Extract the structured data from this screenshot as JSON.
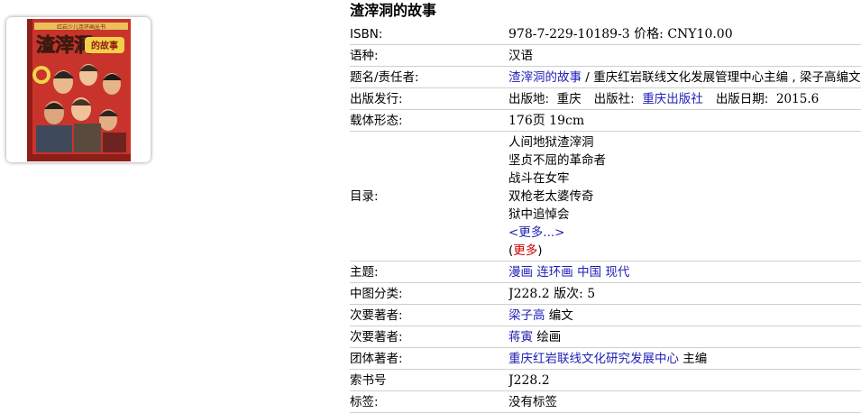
{
  "colors": {
    "link": "#1f1fb5",
    "more_red": "#cc0000",
    "divider": "#cfcfcf"
  },
  "book": {
    "title": "渣滓洞的故事",
    "cover_texts": {
      "series": "红岩少儿连环画丛书",
      "title": "渣滓洞",
      "subtitle": "的故事"
    }
  },
  "labels": {
    "isbn": "ISBN:",
    "language": "语种:",
    "title_resp": "题名/责任者:",
    "publication": "出版发行:",
    "physical": "载体形态:",
    "toc": "目录:",
    "subject": "主题:",
    "clc": "中图分类:",
    "author2a": "次要著者:",
    "author2b": "次要著者:",
    "corporate": "团体著者:",
    "call_no": "索书号",
    "tags": "标签:"
  },
  "values": {
    "isbn": "978-7-229-10189-3 价格:   CNY10.00",
    "language": "汉语",
    "title_link": "渣滓洞的故事",
    "title_rest": " / 重庆红岩联线文化发展管理中心主编 , 梁子高编文",
    "pub_place_label": "出版地:",
    "pub_place": "重庆",
    "publisher_label": "出版社:",
    "publisher": "重庆出版社",
    "pub_date_label": "出版日期:",
    "pub_date": "2015.6",
    "physical": "176页 19cm",
    "toc_items": [
      "人间地狱渣滓洞",
      "坚贞不屈的革命者",
      "战斗在女牢",
      "双枪老太婆传奇",
      "狱中追悼会"
    ],
    "toc_more_link": "<更多...>",
    "toc_more_open": "(",
    "toc_more_red": "更多",
    "toc_more_close": ")",
    "subjects": [
      "漫画",
      "连环画",
      "中国",
      "现代"
    ],
    "clc": "J228.2 版次:   5",
    "author2a_name": "梁子高",
    "author2a_role": " 编文",
    "author2b_name": "蒋寅",
    "author2b_role": " 绘画",
    "corporate_name": "重庆红岩联线文化研究发展中心",
    "corporate_role": " 主编",
    "call_no": "J228.2",
    "tags": "没有标签"
  }
}
